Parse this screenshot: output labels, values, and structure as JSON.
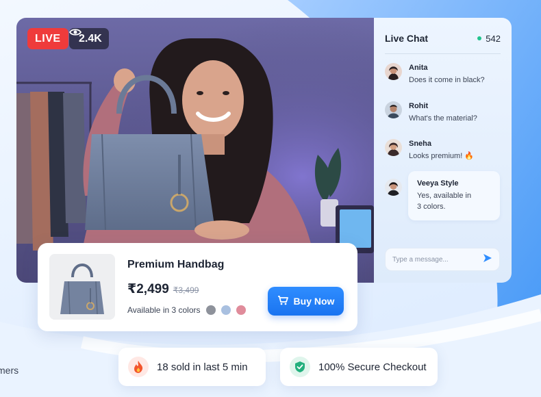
{
  "stream": {
    "live_label": "LIVE",
    "viewers": "2.4K"
  },
  "chat": {
    "title": "Live Chat",
    "online_count": "542",
    "messages": [
      {
        "name": "Anita",
        "text": "Does it come in black?"
      },
      {
        "name": "Rohit",
        "text": "What's the material?"
      },
      {
        "name": "Sneha",
        "text": "Looks premium! 🔥"
      },
      {
        "name": "Veeya Style",
        "text_lines": [
          "Yes, available in",
          "3 colors."
        ]
      }
    ],
    "input_placeholder": "Type a message..."
  },
  "product": {
    "name": "Premium Handbag",
    "price": "₹2,499",
    "original_price": "₹3,499",
    "availability": "Available in 3 colors",
    "colors": [
      "#8e929b",
      "#a9c0e0",
      "#e08c9b"
    ],
    "buy_label": "Buy Now"
  },
  "badges": {
    "sold": "18 sold in last 5 min",
    "secure": "100% Secure Checkout",
    "partial_left": "mers"
  },
  "colors": {
    "live_red": "#ef3b3b",
    "accent_blue": "#1a74f0",
    "online_green": "#22c38e"
  },
  "icons": [
    "eye-icon",
    "send-icon",
    "cart-icon",
    "fire-icon",
    "shield-check-icon"
  ]
}
